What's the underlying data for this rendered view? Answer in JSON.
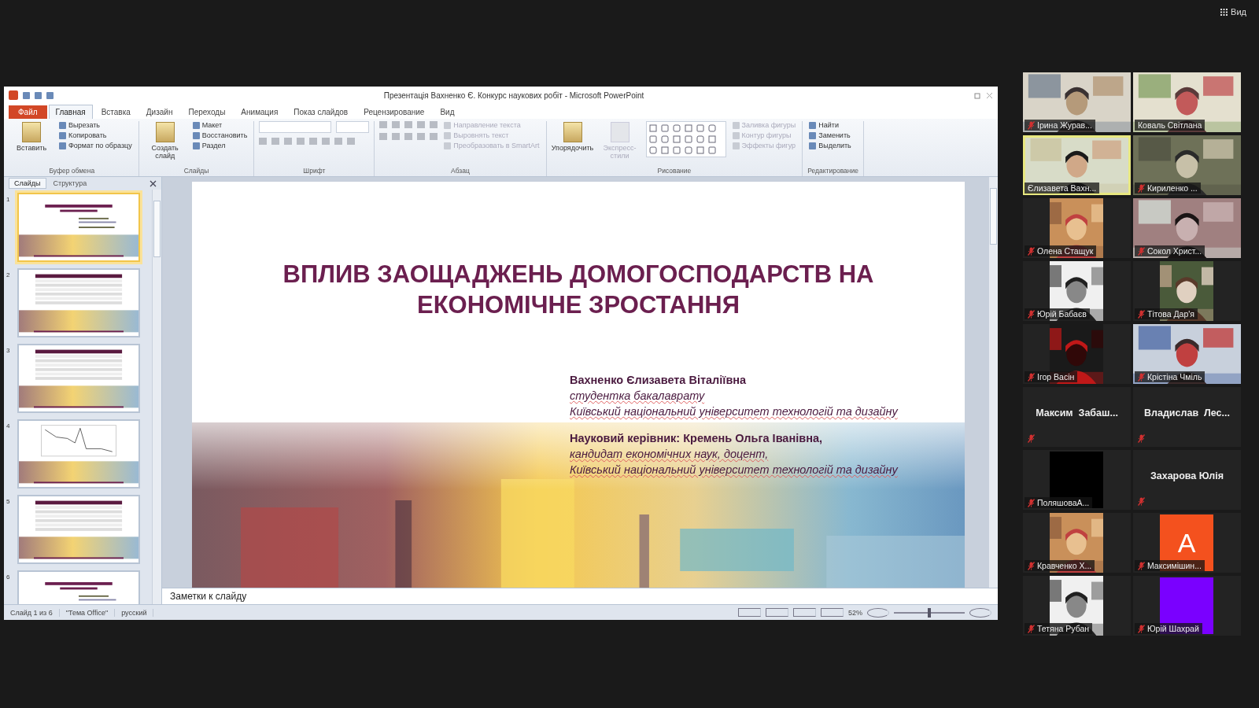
{
  "meeting": {
    "view_button": "Вид"
  },
  "window": {
    "title": "Презентація Вахненко Є. Конкурс наукових робіт - Microsoft PowerPoint"
  },
  "file_tab": "Файл",
  "tabs": [
    {
      "label": "Главная",
      "selected": true
    },
    {
      "label": "Вставка",
      "selected": false
    },
    {
      "label": "Дизайн",
      "selected": false
    },
    {
      "label": "Переходы",
      "selected": false
    },
    {
      "label": "Анимация",
      "selected": false
    },
    {
      "label": "Показ слайдов",
      "selected": false
    },
    {
      "label": "Рецензирование",
      "selected": false
    },
    {
      "label": "Вид",
      "selected": false
    }
  ],
  "ribbon": [
    {
      "label": "Буфер обмена",
      "kind": "clipboard",
      "large": [
        {
          "label": "Вставить",
          "disabled": false
        }
      ],
      "small": [
        {
          "label": "Вырезать",
          "disabled": false
        },
        {
          "label": "Копировать",
          "disabled": false
        },
        {
          "label": "Формат по образцу",
          "disabled": false
        }
      ]
    },
    {
      "label": "Слайды",
      "kind": "plain",
      "large": [
        {
          "label": "Создать слайд",
          "disabled": false
        }
      ],
      "small": [
        {
          "label": "Макет",
          "disabled": false
        },
        {
          "label": "Восстановить",
          "disabled": false
        },
        {
          "label": "Раздел",
          "disabled": false
        }
      ]
    },
    {
      "label": "Шрифт",
      "kind": "font"
    },
    {
      "label": "Абзац",
      "kind": "paragraph",
      "small": [
        {
          "label": "Направление текста",
          "disabled": true
        },
        {
          "label": "Выровнять текст",
          "disabled": true
        },
        {
          "label": "Преобразовать в SmartArt",
          "disabled": true
        }
      ]
    },
    {
      "label": "Рисование",
      "kind": "drawing",
      "large": [
        {
          "label": "Упорядочить",
          "disabled": false
        },
        {
          "label": "Экспресс-стили",
          "disabled": true
        }
      ],
      "small": [
        {
          "label": "Заливка фигуры",
          "disabled": true
        },
        {
          "label": "Контур фигуры",
          "disabled": true
        },
        {
          "label": "Эффекты фигур",
          "disabled": true
        }
      ]
    },
    {
      "label": "Редактирование",
      "kind": "plain",
      "small": [
        {
          "label": "Найти",
          "disabled": false
        },
        {
          "label": "Заменить",
          "disabled": false
        },
        {
          "label": "Выделить",
          "disabled": false
        }
      ]
    }
  ],
  "pane_tabs": [
    {
      "label": "Слайды",
      "selected": true
    },
    {
      "label": "Структура",
      "selected": false
    }
  ],
  "slides": [
    {
      "number": "1",
      "kind": "title",
      "selected": true
    },
    {
      "number": "2",
      "kind": "table",
      "selected": false
    },
    {
      "number": "3",
      "kind": "table",
      "selected": false
    },
    {
      "number": "4",
      "kind": "chart",
      "selected": false
    },
    {
      "number": "5",
      "kind": "table",
      "selected": false
    },
    {
      "number": "6",
      "kind": "title",
      "selected": false
    }
  ],
  "slide": {
    "title_lines": [
      "ВПЛИВ ЗАОЩАДЖЕНЬ ДОМОГОСПОДАРСТВ НА",
      "ЕКОНОМІЧНЕ ЗРОСТАННЯ"
    ],
    "blocks": [
      [
        {
          "text": "Вахненко Єлизавета Віталіївна",
          "kind": "bold"
        },
        {
          "text": "студентка бакалаврату",
          "kind": "italic"
        },
        {
          "text": "Київський національний університет технологій та дизайну",
          "kind": "italic"
        }
      ],
      [
        {
          "text": "Науковий керівник: Кремень Ольга Іванівна,",
          "kind": "bold"
        },
        {
          "text": "кандидат економічних наук, доцент,",
          "kind": "italic"
        },
        {
          "text": "Київський національний університет технологій та дизайну",
          "kind": "italic"
        }
      ]
    ]
  },
  "notes": {
    "placeholder": "Заметки к слайду"
  },
  "status_bar": {
    "slide": "Слайд 1 из 6",
    "theme": "\"Тема Office\"",
    "language": "русский",
    "zoom": "52%",
    "zoom_level": {
      "level": 0.5
    }
  },
  "participants": [
    {
      "name": "Ірина Журав...",
      "kind": "video",
      "muted": true,
      "selected": false
    },
    {
      "name": "Коваль Світлана",
      "kind": "video",
      "muted": false,
      "selected": false
    },
    {
      "name": "Єлизавета Вахн...",
      "kind": "video",
      "muted": false,
      "selected": true
    },
    {
      "name": "Кириленко ...",
      "kind": "video",
      "muted": true,
      "selected": false
    },
    {
      "name": "Олена Стащук",
      "kind": "portrait",
      "muted": true,
      "selected": false
    },
    {
      "name": "Сокол Христ...",
      "kind": "video",
      "muted": true,
      "selected": false
    },
    {
      "name": "Юрій Бабаєв",
      "kind": "portrait",
      "muted": true,
      "selected": false
    },
    {
      "name": "Тітова Дар'я",
      "kind": "portrait",
      "muted": true,
      "selected": false
    },
    {
      "name": "Ігор Васін",
      "kind": "portrait",
      "muted": true,
      "selected": false
    },
    {
      "name": "Крістіна Чміль",
      "kind": "video",
      "muted": true,
      "selected": false
    },
    {
      "name": "Максим  Забаш...",
      "kind": "name",
      "muted": true,
      "selected": false
    },
    {
      "name": "Владислав  Лес...",
      "kind": "name",
      "muted": true,
      "selected": false
    },
    {
      "name": "ПоляшоваА...",
      "kind": "blank",
      "color": "#000000",
      "muted": true,
      "selected": false
    },
    {
      "name": "Захарова Юлія",
      "kind": "name",
      "muted": true,
      "selected": false
    },
    {
      "name": "Кравченко Х...",
      "kind": "portrait",
      "muted": true,
      "selected": false
    },
    {
      "name": "Максимішин...",
      "kind": "avatar",
      "letter": "A",
      "color": "#f4511e",
      "muted": true,
      "selected": false
    },
    {
      "name": "Тетяна Рубан",
      "kind": "portrait",
      "muted": true,
      "selected": false
    },
    {
      "name": "Юрій Шахрай",
      "kind": "blank",
      "color": "#7a00ff",
      "muted": true,
      "selected": false
    }
  ]
}
